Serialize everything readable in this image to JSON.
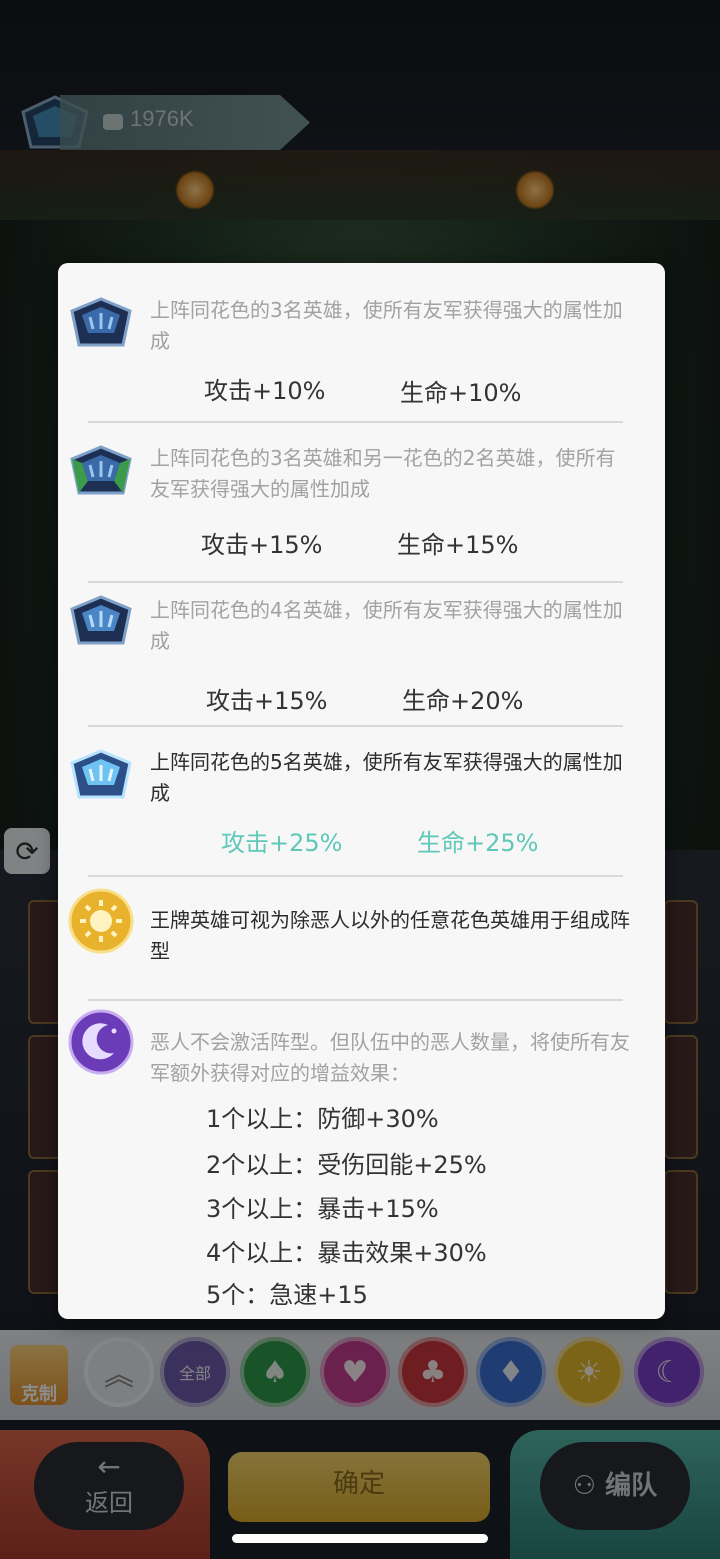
{
  "top": {
    "power_value": "1976K"
  },
  "popup": {
    "entries": [
      {
        "desc": "上阵同花色的3名英雄，使所有友军获得强大的属性加成",
        "attack": "攻击+10%",
        "life": "生命+10%",
        "active": false
      },
      {
        "desc": "上阵同花色的3名英雄和另一花色的2名英雄，使所有友军获得强大的属性加成",
        "attack": "攻击+15%",
        "life": "生命+15%",
        "active": false
      },
      {
        "desc": "上阵同花色的4名英雄，使所有友军获得强大的属性加成",
        "attack": "攻击+15%",
        "life": "生命+20%",
        "active": false
      },
      {
        "desc": "上阵同花色的5名英雄，使所有友军获得强大的属性加成",
        "attack": "攻击+25%",
        "life": "生命+25%",
        "active": true
      }
    ],
    "ace": {
      "desc": "王牌英雄可视为除恶人以外的任意花色英雄用于组成阵型"
    },
    "villain": {
      "desc": "恶人不会激活阵型。但队伍中的恶人数量，将使所有友军额外获得对应的增益效果：",
      "bonuses": [
        "1个以上：防御+30%",
        "2个以上：受伤回能+25%",
        "3个以上：暴击+15%",
        "4个以上：暴击效果+30%",
        "5个：急速+15"
      ]
    }
  },
  "filters": {
    "restrain_label": "克制",
    "all_label": "全部",
    "colors": [
      "#2f9a4a",
      "#c23c8f",
      "#c9383d",
      "#3a6fd0",
      "#e2b62a",
      "#7b3fc6"
    ]
  },
  "nav": {
    "back_label": "返回",
    "confirm_label": "确定",
    "team_label": "编队"
  },
  "colors": {
    "active_stat": "#5ec8b9",
    "inactive_text": "#a2a2a2"
  }
}
